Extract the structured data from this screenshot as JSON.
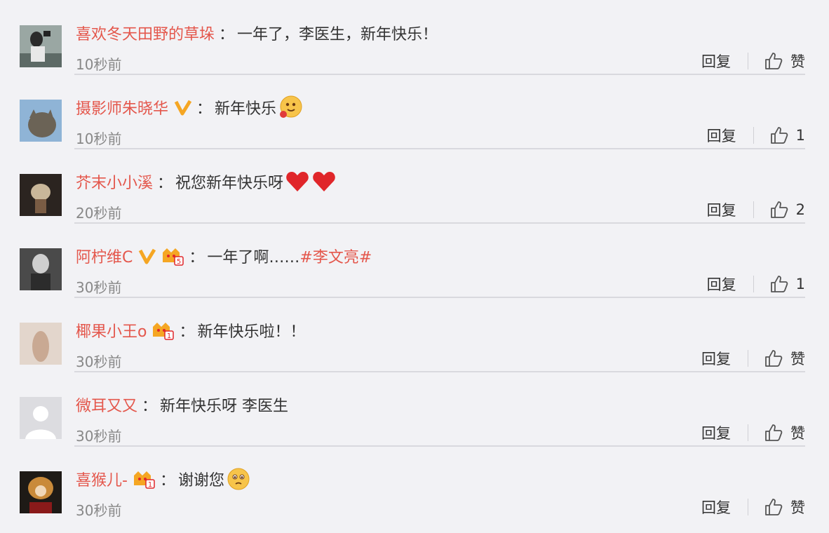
{
  "comments": [
    {
      "username": "喜欢冬天田野的草垛",
      "text": "一年了，李医生，新年快乐！",
      "time": "10秒前",
      "reply_label": "回复",
      "like_label": "赞",
      "avatar": "woman-with-camera"
    },
    {
      "username": "摄影师朱晓华",
      "text": "新年快乐",
      "time": "10秒前",
      "reply_label": "回复",
      "like_label": "1",
      "avatar": "cat-photo",
      "badge": "verified-v",
      "emoji": "hug-emoji"
    },
    {
      "username": "芥末小小溪",
      "text": "祝您新年快乐呀",
      "time": "20秒前",
      "reply_label": "回复",
      "like_label": "2",
      "avatar": "dark-figure",
      "emoji": "two-hearts"
    },
    {
      "username": "阿柠维C",
      "text": "一年了啊……",
      "hashtag": "#李文亮#",
      "time": "30秒前",
      "reply_label": "回复",
      "like_label": "1",
      "avatar": "bw-portrait",
      "badge": "verified-v",
      "vip_level": "5"
    },
    {
      "username": "椰果小王o",
      "text": "新年快乐啦！！",
      "time": "30秒前",
      "reply_label": "回复",
      "like_label": "赞",
      "avatar": "pale-figure",
      "vip_level": "1"
    },
    {
      "username": "微耳又又",
      "text": "新年快乐呀 李医生",
      "time": "30秒前",
      "reply_label": "回复",
      "like_label": "赞",
      "avatar": "default-avatar"
    },
    {
      "username": "喜猴儿-",
      "text": "谢谢您",
      "time": "30秒前",
      "reply_label": "回复",
      "like_label": "赞",
      "avatar": "lantern-character",
      "vip_level": "1",
      "emoji": "pleading-emoji"
    }
  ],
  "colors": {
    "username": "#e4574c",
    "text": "#333333",
    "time": "#888888",
    "background": "#f2f2f5",
    "badge_v": "#f5a623"
  }
}
